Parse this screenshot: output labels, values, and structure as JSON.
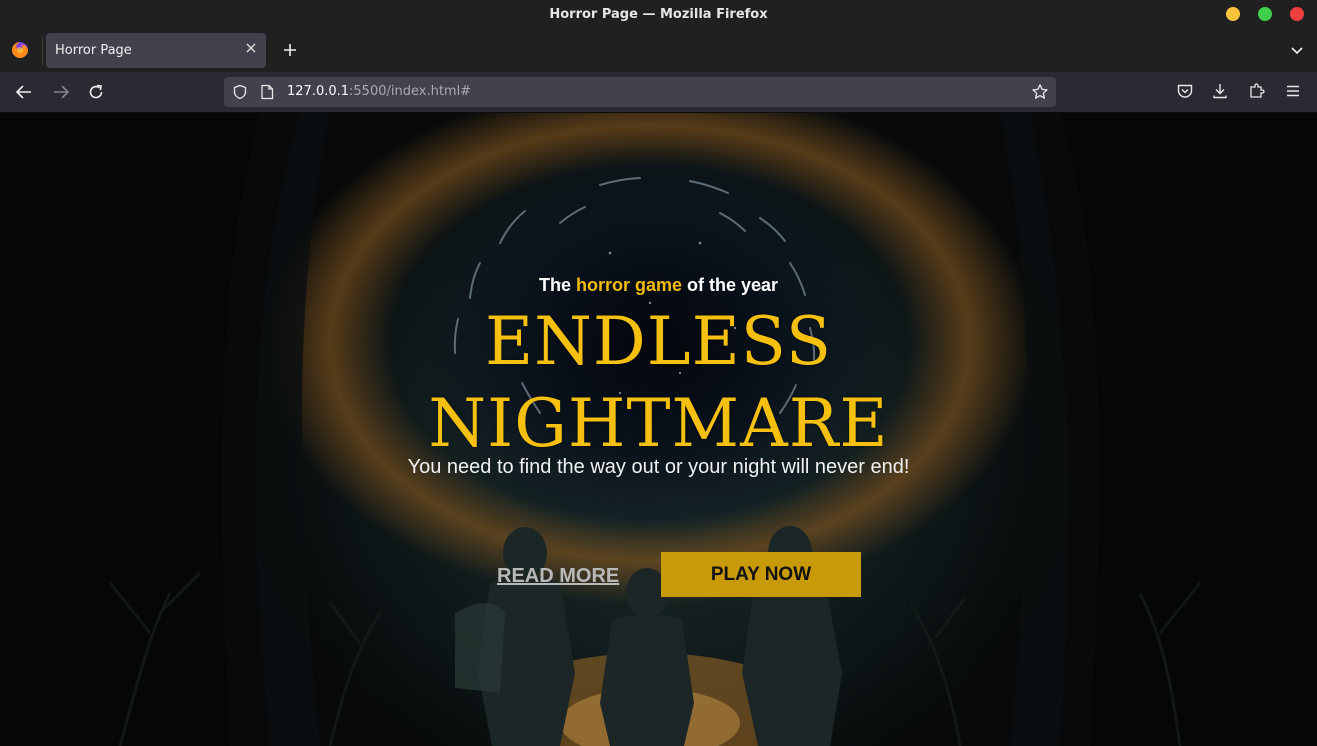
{
  "window": {
    "title": "Horror Page — Mozilla Firefox"
  },
  "browser": {
    "tab_title": "Horror Page",
    "url_host": "127.0.0.1",
    "url_rest": ":5500/index.html#"
  },
  "hero": {
    "tagline_start": "The ",
    "tagline_highlight": "horror game",
    "tagline_end": " of the year",
    "title_line1": "ENDLESS",
    "title_line2": "NIGHTMARE",
    "subtitle": "You need to find the way out or your night will never end!",
    "read_more": "READ MORE",
    "play_now": "PLAY NOW"
  },
  "colors": {
    "accent": "#f5c010",
    "play_button": "#c89a07",
    "browser_chrome": "#2b2a33"
  },
  "icons": [
    "firefox-logo-icon",
    "close-icon",
    "plus-icon",
    "chevron-down-icon",
    "back-arrow-icon",
    "forward-arrow-icon",
    "reload-icon",
    "shield-icon",
    "page-icon",
    "star-icon",
    "pocket-icon",
    "download-icon",
    "extensions-icon",
    "hamburger-menu-icon"
  ]
}
